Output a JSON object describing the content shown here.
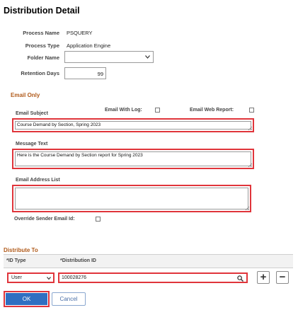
{
  "page": {
    "title": "Distribution Detail"
  },
  "process": {
    "name_label": "Process Name",
    "name_value": "PSQUERY",
    "type_label": "Process Type",
    "type_value": "Application Engine",
    "folder_label": "Folder Name",
    "folder_value": "",
    "retention_label": "Retention Days",
    "retention_value": "99"
  },
  "email": {
    "section_title": "Email Only",
    "subject_label": "Email Subject",
    "subject_value": "Course Demand by Section, Spring 2023",
    "with_log_label": "Email With Log:",
    "web_report_label": "Email Web Report:",
    "message_label": "Message Text",
    "message_value": "Here is the Course Demand by Section report for Spring 2023",
    "address_label": "Email Address List",
    "address_value": "",
    "override_label": "Override Sender Email Id:"
  },
  "distribute": {
    "section_title": "Distribute To",
    "col_id_type": "*ID Type",
    "col_dist_id": "*Distribution ID",
    "rows": [
      {
        "id_type": "User",
        "dist_id": "100028276"
      }
    ]
  },
  "buttons": {
    "ok": "OK",
    "cancel": "Cancel",
    "add": "+",
    "remove": "−"
  },
  "colors": {
    "highlight": "#e0353b",
    "section": "#b05a1a",
    "primary": "#2f6fc1"
  }
}
